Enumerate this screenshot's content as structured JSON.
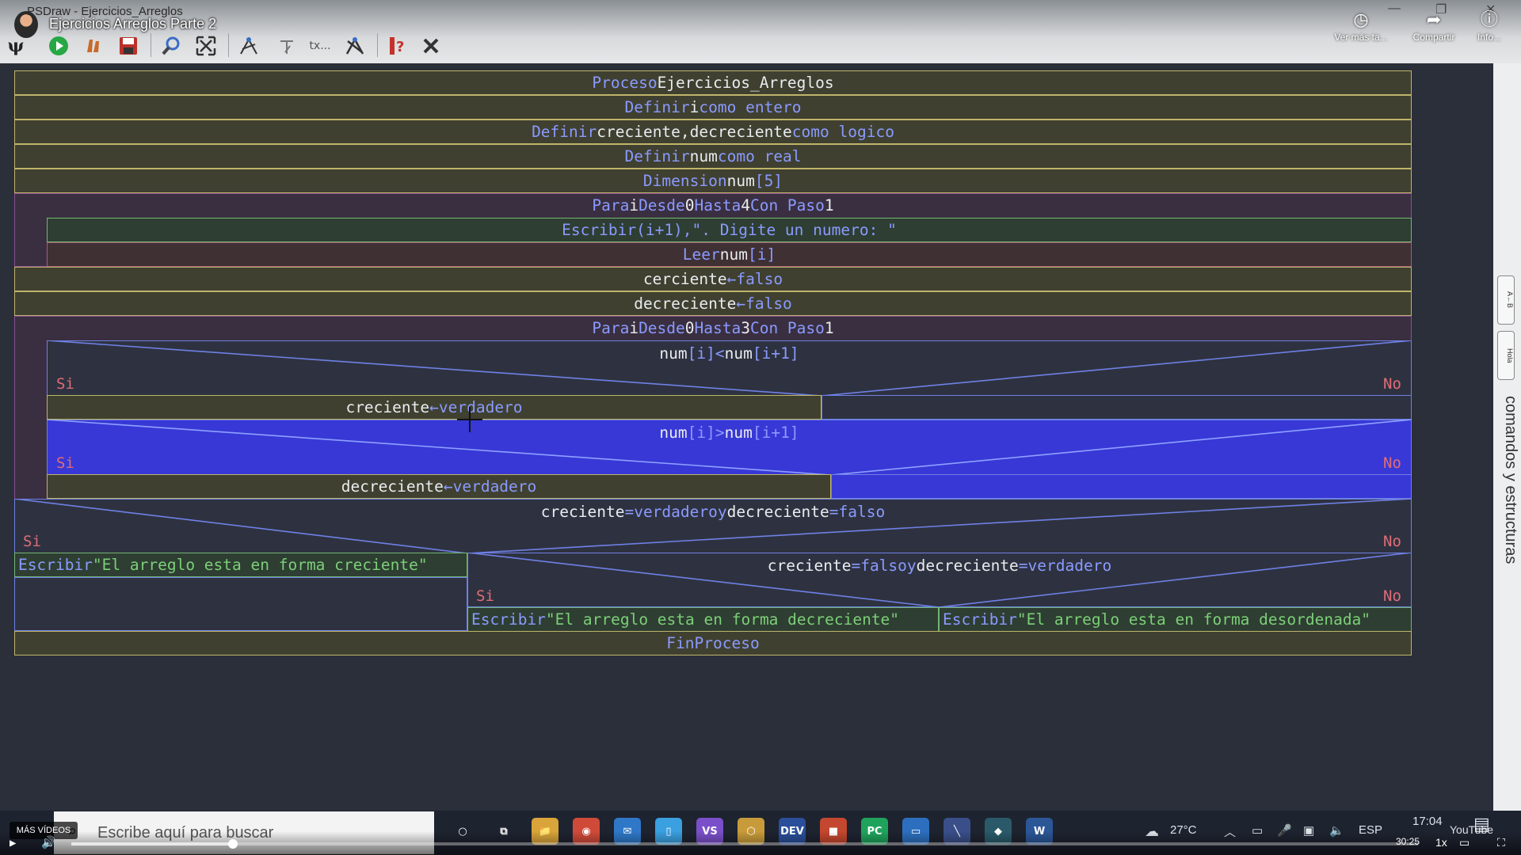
{
  "window": {
    "title": "PSDraw - Ejercicios_Arreglos",
    "video_title": "Ejercicios Arreglos Parte 2",
    "yt_actions": [
      {
        "icon": "clock-icon",
        "label": "Ver más ta..."
      },
      {
        "icon": "share-icon",
        "label": "Compartir"
      },
      {
        "icon": "info-icon",
        "label": "Info..."
      }
    ]
  },
  "toolbar": {
    "tools": [
      "psi-logo-icon",
      "run-icon",
      "step-icon",
      "save-icon",
      "zoom-icon",
      "fit-icon",
      "edit-icon",
      "comment-icon",
      "text-icon",
      "tool-icon",
      "help-icon",
      "close-icon"
    ]
  },
  "side_panel": {
    "vertical_label": "comandos y estructuras",
    "tabs": [
      "A←B",
      "Hola"
    ]
  },
  "diagram": {
    "proceso": {
      "kw": "Proceso",
      "name": "Ejercicios_Arreglos"
    },
    "def1": {
      "kw": "Definir",
      "var": "i",
      "kw2": "como entero"
    },
    "def2": {
      "kw": "Definir",
      "var": "creciente,decreciente",
      "kw2": "como logico"
    },
    "def3": {
      "kw": "Definir",
      "var": "num",
      "kw2": "como real"
    },
    "dim": {
      "kw": "Dimension",
      "var": "num",
      "idx": "[5]"
    },
    "para1": {
      "kw": "Para",
      "var": "i",
      "kw2": "Desde",
      "from": "0",
      "kw3": "Hasta",
      "to": "4",
      "kw4": "Con Paso",
      "step": "1"
    },
    "escribir1": {
      "kw": "Escribir",
      "args": "(i+1),\". Digite un numero: \""
    },
    "leer": {
      "kw": "Leer",
      "var": "num",
      "idx": "[i]"
    },
    "asig1": {
      "var": "cerciente",
      "op": "←",
      "val": "falso"
    },
    "asig2": {
      "var": "decreciente",
      "op": "←",
      "val": "falso"
    },
    "para2": {
      "kw": "Para",
      "var": "i",
      "kw2": "Desde",
      "from": "0",
      "kw3": "Hasta",
      "to": "3",
      "kw4": "Con Paso",
      "step": "1"
    },
    "cond1": {
      "a": "num",
      "ai": "[i]",
      "op": "<",
      "b": "num",
      "bi": "[i+1]"
    },
    "asig3": {
      "var": "creciente",
      "op": "←",
      "val": "verdadero"
    },
    "cond2": {
      "a": "num",
      "ai": "[i]",
      "op": ">",
      "b": "num",
      "bi": "[i+1]"
    },
    "asig4": {
      "var": "decreciente",
      "op": "←",
      "val": "verdadero"
    },
    "cond3": {
      "a": "creciente",
      "op1": "=",
      "v1": "verdadero",
      "and": "y",
      "b": "decreciente",
      "op2": "=",
      "v2": "falso"
    },
    "escribir2": {
      "kw": "Escribir",
      "str": "\"El arreglo esta en forma creciente\""
    },
    "cond4": {
      "a": "creciente",
      "op1": "=",
      "v1": "falso",
      "and": "y",
      "b": "decreciente",
      "op2": "=",
      "v2": "verdadero"
    },
    "escribir3": {
      "kw": "Escribir",
      "str": "\"El arreglo esta en forma decreciente\""
    },
    "escribir4": {
      "kw": "Escribir",
      "str": "\"El arreglo esta en forma desordenada\""
    },
    "fin": {
      "kw": "FinProceso"
    },
    "si": "Si",
    "no": "No"
  },
  "taskbar": {
    "search_placeholder": "Escribe aquí para buscar",
    "more_videos": "MÁS VÍDEOS",
    "apps": [
      {
        "name": "cortana",
        "label": "○",
        "color": "#1e2330"
      },
      {
        "name": "task-view",
        "label": "⧉",
        "color": "#1e2330"
      },
      {
        "name": "explorer",
        "label": "📁",
        "color": "#d9a43a"
      },
      {
        "name": "chrome",
        "label": "◉",
        "color": "#d04a3a"
      },
      {
        "name": "mail",
        "label": "✉",
        "color": "#2f78c8"
      },
      {
        "name": "notepad",
        "label": "▯",
        "color": "#3aa0e0"
      },
      {
        "name": "visual-studio",
        "label": "VS",
        "color": "#7b4fc9"
      },
      {
        "name": "app-hex",
        "label": "⬡",
        "color": "#c89b3a"
      },
      {
        "name": "dev",
        "label": "DEV",
        "color": "#2b4f9a"
      },
      {
        "name": "office",
        "label": "■",
        "color": "#c4472f"
      },
      {
        "name": "pycharm",
        "label": "PC",
        "color": "#1fa35b"
      },
      {
        "name": "app-blue",
        "label": "▭",
        "color": "#2d6fbf"
      },
      {
        "name": "pseint",
        "label": "╲",
        "color": "#3a4f8a"
      },
      {
        "name": "psdraw",
        "label": "◆",
        "color": "#2a5a6a"
      },
      {
        "name": "word",
        "label": "W",
        "color": "#2b5797"
      }
    ],
    "weather": "27°C",
    "lang": "ESP",
    "time": "17:04",
    "video_time": "30:25",
    "speed": "1x",
    "progress": 0.12,
    "watermark": "YouTube"
  }
}
